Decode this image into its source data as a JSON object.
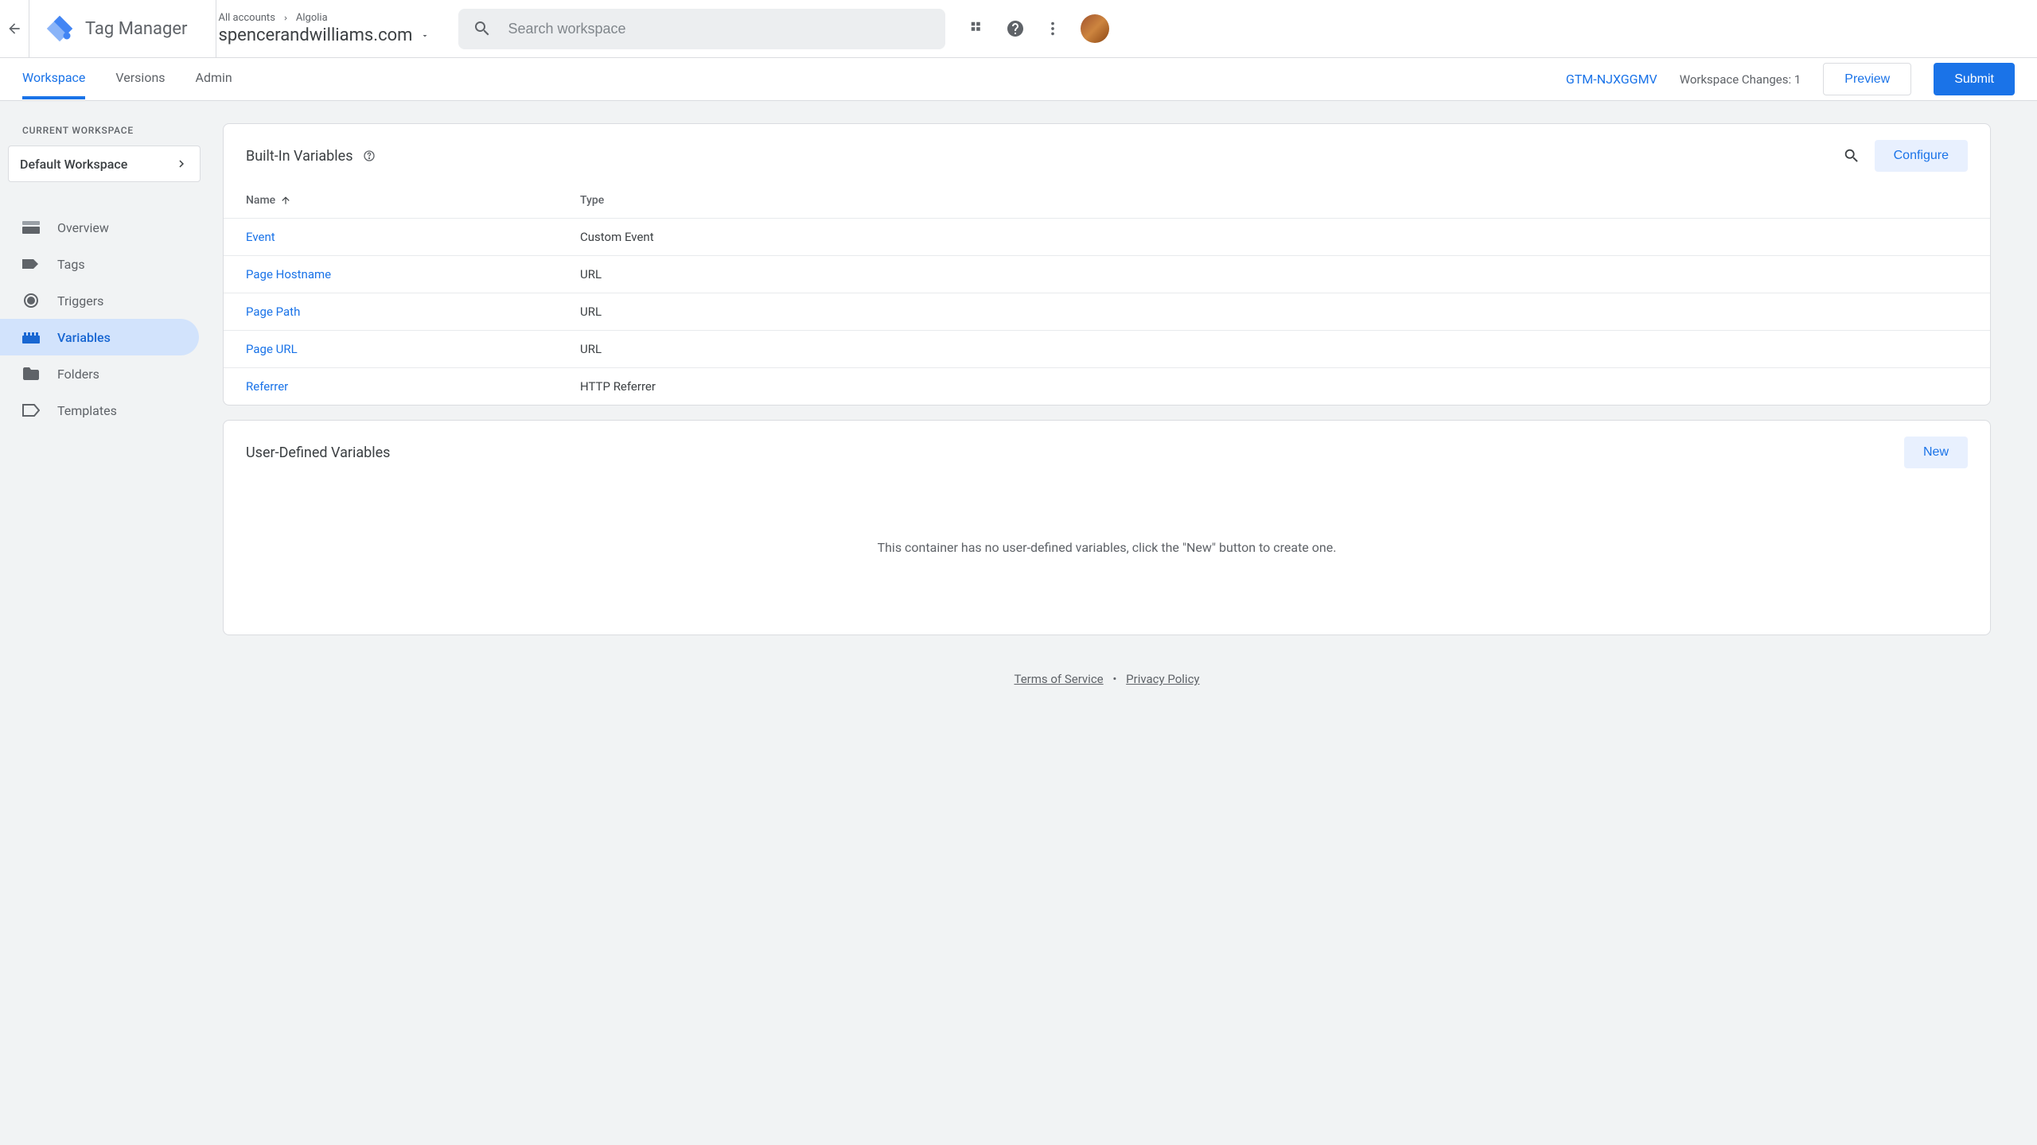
{
  "header": {
    "product_name": "Tag Manager",
    "breadcrumb_all": "All accounts",
    "breadcrumb_account": "Algolia",
    "container_name": "spencerandwilliams.com",
    "search_placeholder": "Search workspace"
  },
  "nav": {
    "tabs": [
      "Workspace",
      "Versions",
      "Admin"
    ],
    "active_tab": 0,
    "gtm_id": "GTM-NJXGGMV",
    "workspace_changes_label": "Workspace Changes:",
    "workspace_changes_count": "1",
    "preview_btn": "Preview",
    "submit_btn": "Submit"
  },
  "sidebar": {
    "label": "CURRENT WORKSPACE",
    "workspace_name": "Default Workspace",
    "items": [
      {
        "label": "Overview",
        "icon": "overview"
      },
      {
        "label": "Tags",
        "icon": "tag"
      },
      {
        "label": "Triggers",
        "icon": "target"
      },
      {
        "label": "Variables",
        "icon": "variables"
      },
      {
        "label": "Folders",
        "icon": "folder"
      },
      {
        "label": "Templates",
        "icon": "template"
      }
    ],
    "active_index": 3
  },
  "builtin": {
    "title": "Built-In Variables",
    "configure_btn": "Configure",
    "col_name": "Name",
    "col_type": "Type",
    "rows": [
      {
        "name": "Event",
        "type": "Custom Event"
      },
      {
        "name": "Page Hostname",
        "type": "URL"
      },
      {
        "name": "Page Path",
        "type": "URL"
      },
      {
        "name": "Page URL",
        "type": "URL"
      },
      {
        "name": "Referrer",
        "type": "HTTP Referrer"
      }
    ]
  },
  "userdef": {
    "title": "User-Defined Variables",
    "new_btn": "New",
    "empty_text": "This container has no user-defined variables, click the \"New\" button to create one."
  },
  "footer": {
    "tos": "Terms of Service",
    "privacy": "Privacy Policy"
  }
}
